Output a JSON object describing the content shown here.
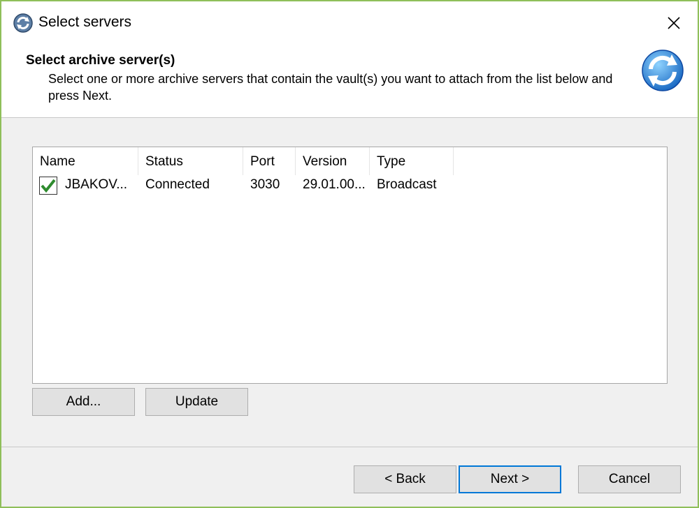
{
  "window": {
    "title": "Select servers",
    "border_color": "#8fbf5a"
  },
  "header": {
    "title": "Select archive server(s)",
    "description": "Select one or more archive servers that contain the vault(s) you want to attach from the list below and press Next.",
    "icon": "sync-arrows-icon"
  },
  "list": {
    "columns": [
      "Name",
      "Status",
      "Port",
      "Version",
      "Type"
    ],
    "rows": [
      {
        "checked": true,
        "name": "JBAKOV...",
        "status": "Connected",
        "port": "3030",
        "version": "29.01.00...",
        "type": "Broadcast"
      }
    ]
  },
  "list_buttons": {
    "add": "Add...",
    "update": "Update"
  },
  "footer_buttons": {
    "back": "< Back",
    "next": "Next >",
    "cancel": "Cancel"
  },
  "colors": {
    "accent": "#0078d7",
    "check": "#2e8b2e"
  }
}
